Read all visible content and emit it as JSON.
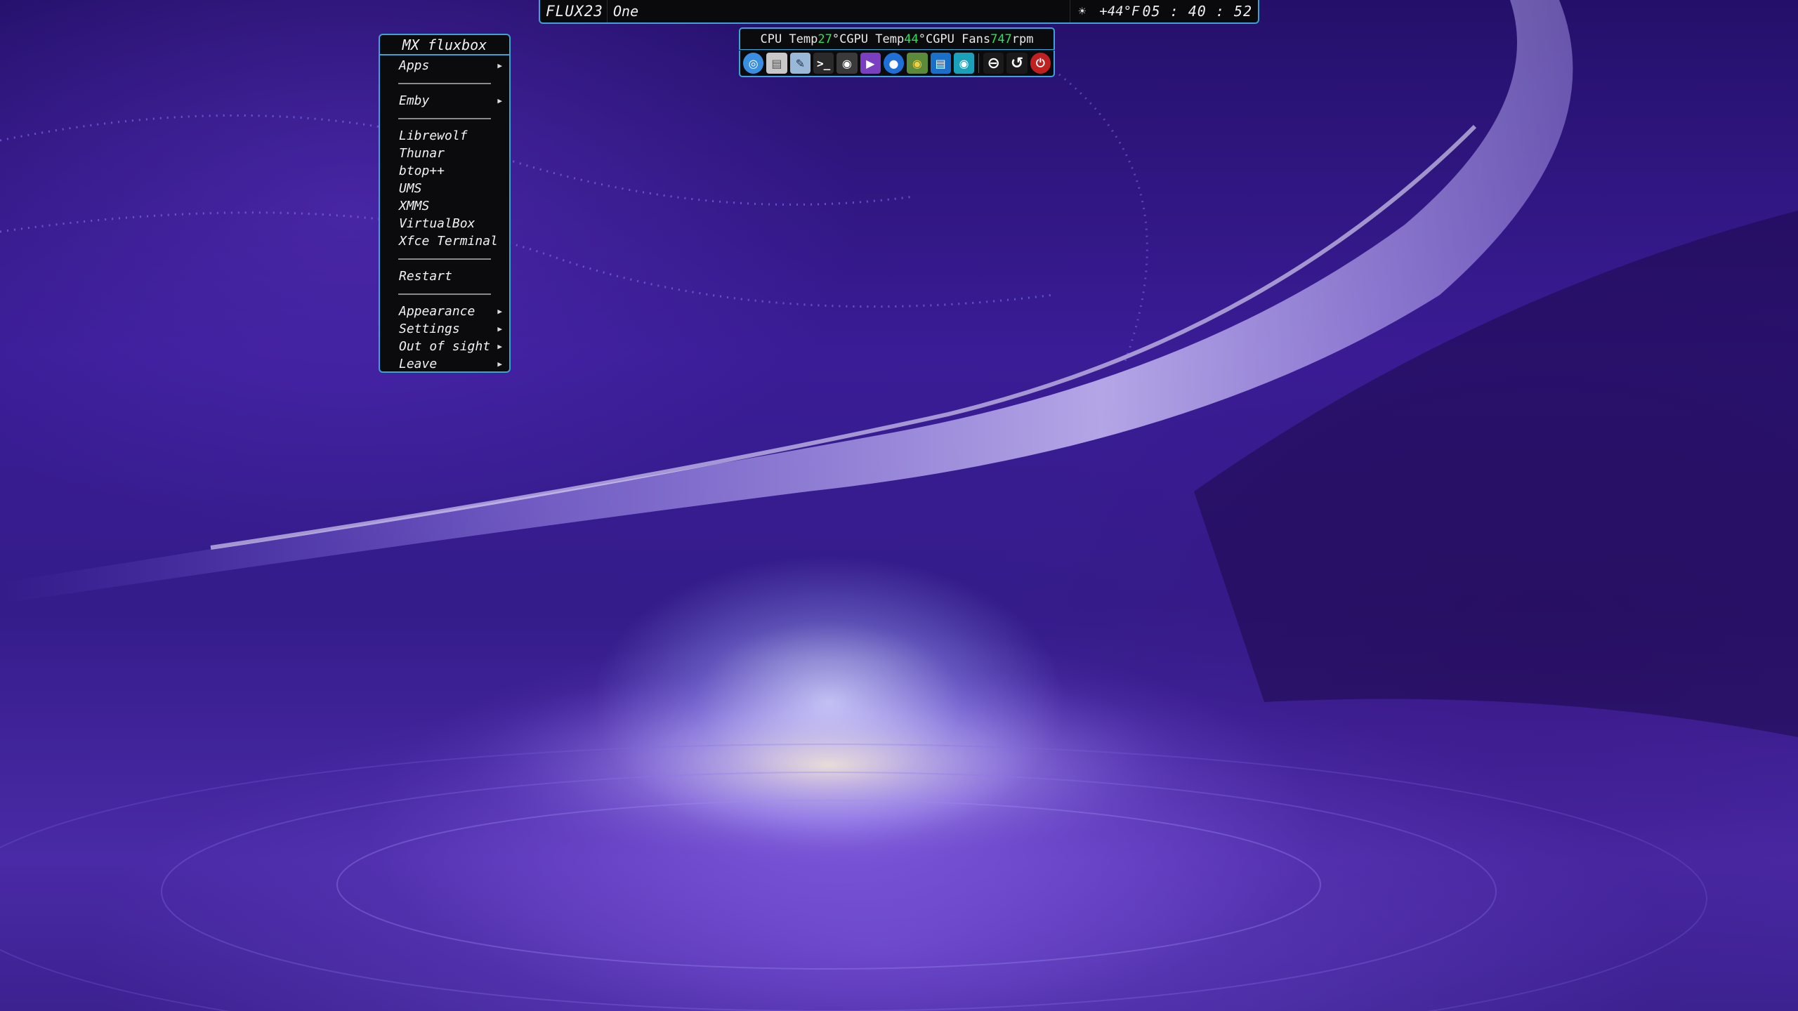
{
  "toolbar": {
    "logo_text": "FLUX23",
    "workspace_name": "One",
    "weather_icon": "sun-icon",
    "weather_temp": "+44°F",
    "clock": "05 : 40 : 52"
  },
  "sensors": {
    "cpu_label": "CPU Temp ",
    "cpu_value": "27",
    "cpu_unit": "°C ",
    "gpu_label": "GPU Temp ",
    "gpu_value": "44",
    "gpu_unit": "°C ",
    "fan_label": "GPU Fans ",
    "fan_value": "747",
    "fan_unit": "rpm"
  },
  "dock": {
    "items": [
      {
        "name": "browser-icon",
        "color": "#3b8fe0"
      },
      {
        "name": "file-manager-icon",
        "color": "#c8c8c8"
      },
      {
        "name": "text-editor-icon",
        "color": "#9ab8d8"
      },
      {
        "name": "terminal-icon",
        "color": "#2a2a2a"
      },
      {
        "name": "gaming-icon",
        "color": "#3a3a3a"
      },
      {
        "name": "media-player-icon",
        "color": "#7a3fc0"
      },
      {
        "name": "globe-icon",
        "color": "#1e6fd6"
      },
      {
        "name": "media-server-icon",
        "color": "#5b8a3a"
      },
      {
        "name": "system-monitor-icon",
        "color": "#1a6fc8"
      },
      {
        "name": "screenshot-icon",
        "color": "#1aa0b8"
      },
      {
        "name": "minus-circle-icon",
        "color": "#2a2a2a"
      },
      {
        "name": "refresh-icon",
        "color": "#2a2a2a"
      },
      {
        "name": "power-icon",
        "color": "#c02020"
      }
    ]
  },
  "rootmenu": {
    "title": "MX fluxbox",
    "items": [
      {
        "type": "item",
        "label": "Apps",
        "submenu": true
      },
      {
        "type": "sep"
      },
      {
        "type": "item",
        "label": "Emby",
        "submenu": true
      },
      {
        "type": "sep"
      },
      {
        "type": "item",
        "label": "Librewolf",
        "submenu": false
      },
      {
        "type": "item",
        "label": "Thunar",
        "submenu": false
      },
      {
        "type": "item",
        "label": "btop++",
        "submenu": false
      },
      {
        "type": "item",
        "label": "UMS",
        "submenu": false
      },
      {
        "type": "item",
        "label": "XMMS",
        "submenu": false
      },
      {
        "type": "item",
        "label": "VirtualBox",
        "submenu": false
      },
      {
        "type": "item",
        "label": "Xfce Terminal",
        "submenu": false
      },
      {
        "type": "sep"
      },
      {
        "type": "item",
        "label": "Restart",
        "submenu": false
      },
      {
        "type": "sep"
      },
      {
        "type": "item",
        "label": "Appearance",
        "submenu": true
      },
      {
        "type": "item",
        "label": "Settings",
        "submenu": true
      },
      {
        "type": "item",
        "label": "Out of sight",
        "submenu": true
      },
      {
        "type": "item",
        "label": "Leave",
        "submenu": true
      }
    ]
  },
  "colors": {
    "accent_border": "#3aa4d8",
    "sensor_value": "#2ee05a",
    "panel_bg": "#0b0b0d"
  }
}
